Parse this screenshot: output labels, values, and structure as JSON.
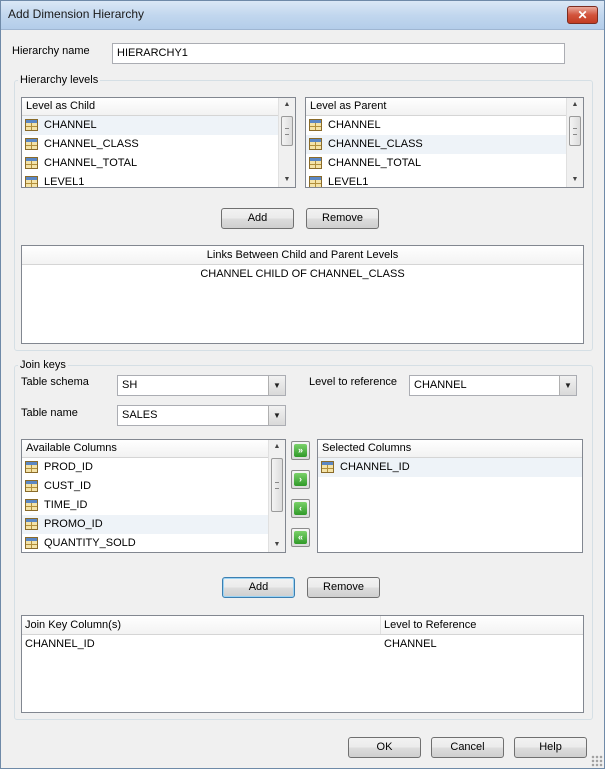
{
  "window": {
    "title": "Add Dimension Hierarchy",
    "close_glyph": "✕"
  },
  "hierarchy_name": {
    "label": "Hierarchy name",
    "value": "HIERARCHY1"
  },
  "hierarchy_levels": {
    "title": "Hierarchy levels",
    "child_list": {
      "header": "Level as Child",
      "items": [
        "CHANNEL",
        "CHANNEL_CLASS",
        "CHANNEL_TOTAL",
        "LEVEL1"
      ],
      "selected_index": 0
    },
    "parent_list": {
      "header": "Level as Parent",
      "items": [
        "CHANNEL",
        "CHANNEL_CLASS",
        "CHANNEL_TOTAL",
        "LEVEL1"
      ],
      "selected_index": 1
    },
    "add_label": "Add",
    "remove_label": "Remove",
    "links": {
      "header": "Links Between Child and Parent Levels",
      "rows": [
        "CHANNEL CHILD OF CHANNEL_CLASS"
      ]
    }
  },
  "join_keys": {
    "title": "Join keys",
    "table_schema": {
      "label": "Table schema",
      "value": "SH"
    },
    "table_name": {
      "label": "Table name",
      "value": "SALES"
    },
    "level_to_reference": {
      "label": "Level to reference",
      "value": "CHANNEL"
    },
    "available_columns": {
      "header": "Available Columns",
      "items": [
        "PROD_ID",
        "CUST_ID",
        "TIME_ID",
        "PROMO_ID",
        "QUANTITY_SOLD"
      ],
      "selected_index": 3
    },
    "selected_columns": {
      "header": "Selected Columns",
      "items": [
        "CHANNEL_ID"
      ],
      "selected_index": 0
    },
    "move_buttons": {
      "add_all": "»",
      "add": "›",
      "remove": "‹",
      "remove_all": "«"
    },
    "add_label": "Add",
    "remove_label": "Remove",
    "join_table": {
      "headers": [
        "Join Key Column(s)",
        "Level to Reference"
      ],
      "rows": [
        [
          "CHANNEL_ID",
          "CHANNEL"
        ]
      ]
    }
  },
  "footer": {
    "ok_label": "OK",
    "cancel_label": "Cancel",
    "help_label": "Help"
  },
  "icons": {
    "list_item": "table-icon",
    "dropdown": "chevron-down-icon"
  },
  "colors": {
    "title_bar": "#c2d7ee",
    "close_button": "#c23b22",
    "move_button": "#2f9a28"
  }
}
